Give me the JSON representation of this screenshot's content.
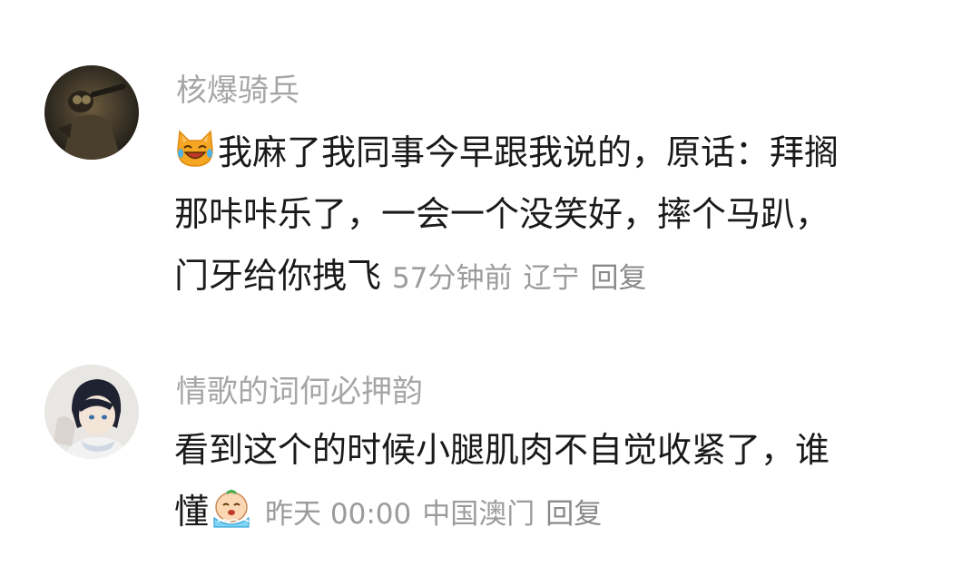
{
  "comments": [
    {
      "username": "核爆骑兵",
      "emoji": "cat-laughing-emoji",
      "text_line1": "我麻了我同事今早跟我说的，原话：拜搁",
      "text_line2": "那咔咔乐了，一会一个没笑好，摔个马趴，",
      "text_line3": "门牙给你拽飞",
      "time": "57分钟前",
      "location": "辽宁",
      "reply_label": "回复"
    },
    {
      "username": "情歌的词何必押韵",
      "text_line1": "看到这个的时候小腿肌肉不自觉收紧了，谁",
      "text_line2": "懂",
      "emoji": "crying-face-emoji",
      "time": "昨天 00:00",
      "location": "中国澳门",
      "reply_label": "回复"
    }
  ]
}
